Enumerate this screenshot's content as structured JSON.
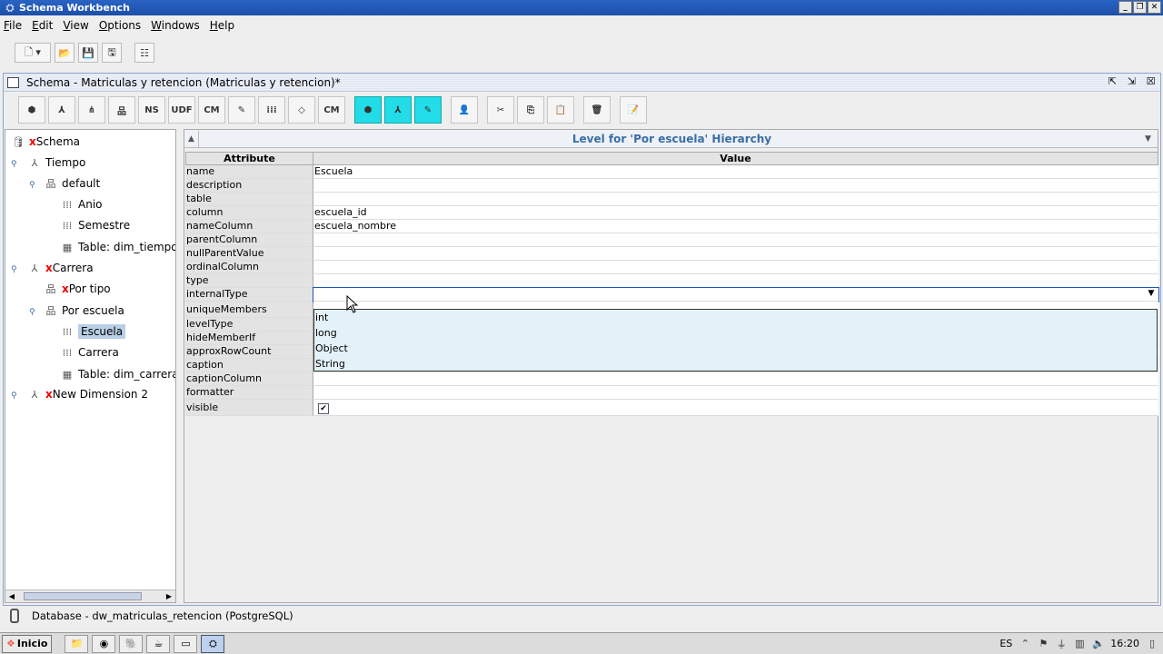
{
  "window": {
    "title": "Schema Workbench"
  },
  "menu": {
    "items": [
      {
        "key": "file",
        "underline": "F",
        "rest": "ile"
      },
      {
        "key": "edit",
        "underline": "E",
        "rest": "dit"
      },
      {
        "key": "view",
        "underline": "V",
        "rest": "iew"
      },
      {
        "key": "options",
        "underline": "O",
        "rest": "ptions"
      },
      {
        "key": "windows",
        "underline": "W",
        "rest": "indows"
      },
      {
        "key": "help",
        "underline": "H",
        "rest": "elp"
      }
    ]
  },
  "schema_window": {
    "title": "Schema - Matriculas y retencion (Matriculas y retencion)*"
  },
  "schema_toolbar": {
    "ns_label": "NS",
    "udf_label": "UDF",
    "cm_label": "CM",
    "cm2_label": "CM"
  },
  "tree": {
    "schema_prefix": "x",
    "schema": "Schema",
    "tiempo": "Tiempo",
    "default": "default",
    "anio": "Anio",
    "semestre": "Semestre",
    "table_tiempo": "Table: dim_tiempo",
    "carrera_prefix": "x",
    "carrera": "Carrera",
    "portipo_prefix": "x",
    "portipo": "Por tipo",
    "porescuela": "Por escuela",
    "escuela": "Escuela",
    "carrera_level": "Carrera",
    "table_carrera": "Table: dim_carrera",
    "newdim_prefix": "x",
    "newdim": "New Dimension 2"
  },
  "level_panel": {
    "title": "Level for 'Por escuela' Hierarchy",
    "col_attribute": "Attribute",
    "col_value": "Value",
    "rows": [
      {
        "attr": "name",
        "value": "Escuela"
      },
      {
        "attr": "description",
        "value": ""
      },
      {
        "attr": "table",
        "value": ""
      },
      {
        "attr": "column",
        "value": "escuela_id"
      },
      {
        "attr": "nameColumn",
        "value": "escuela_nombre"
      },
      {
        "attr": "parentColumn",
        "value": ""
      },
      {
        "attr": "nullParentValue",
        "value": ""
      },
      {
        "attr": "ordinalColumn",
        "value": ""
      },
      {
        "attr": "type",
        "value": ""
      },
      {
        "attr": "internalType",
        "value": ""
      },
      {
        "attr": "uniqueMembers",
        "value": ""
      },
      {
        "attr": "levelType",
        "value": ""
      },
      {
        "attr": "hideMemberIf",
        "value": ""
      },
      {
        "attr": "approxRowCount",
        "value": ""
      },
      {
        "attr": "caption",
        "value": ""
      },
      {
        "attr": "captionColumn",
        "value": ""
      },
      {
        "attr": "formatter",
        "value": ""
      },
      {
        "attr": "visible",
        "value": ""
      }
    ],
    "internal_type_options": [
      "int",
      "long",
      "Object",
      "String"
    ],
    "visible_checked": "✔"
  },
  "status": {
    "text": "Database - dw_matriculas_retencion (PostgreSQL)"
  },
  "taskbar": {
    "start_label": "Inicio",
    "language": "ES",
    "clock": "16:20"
  }
}
